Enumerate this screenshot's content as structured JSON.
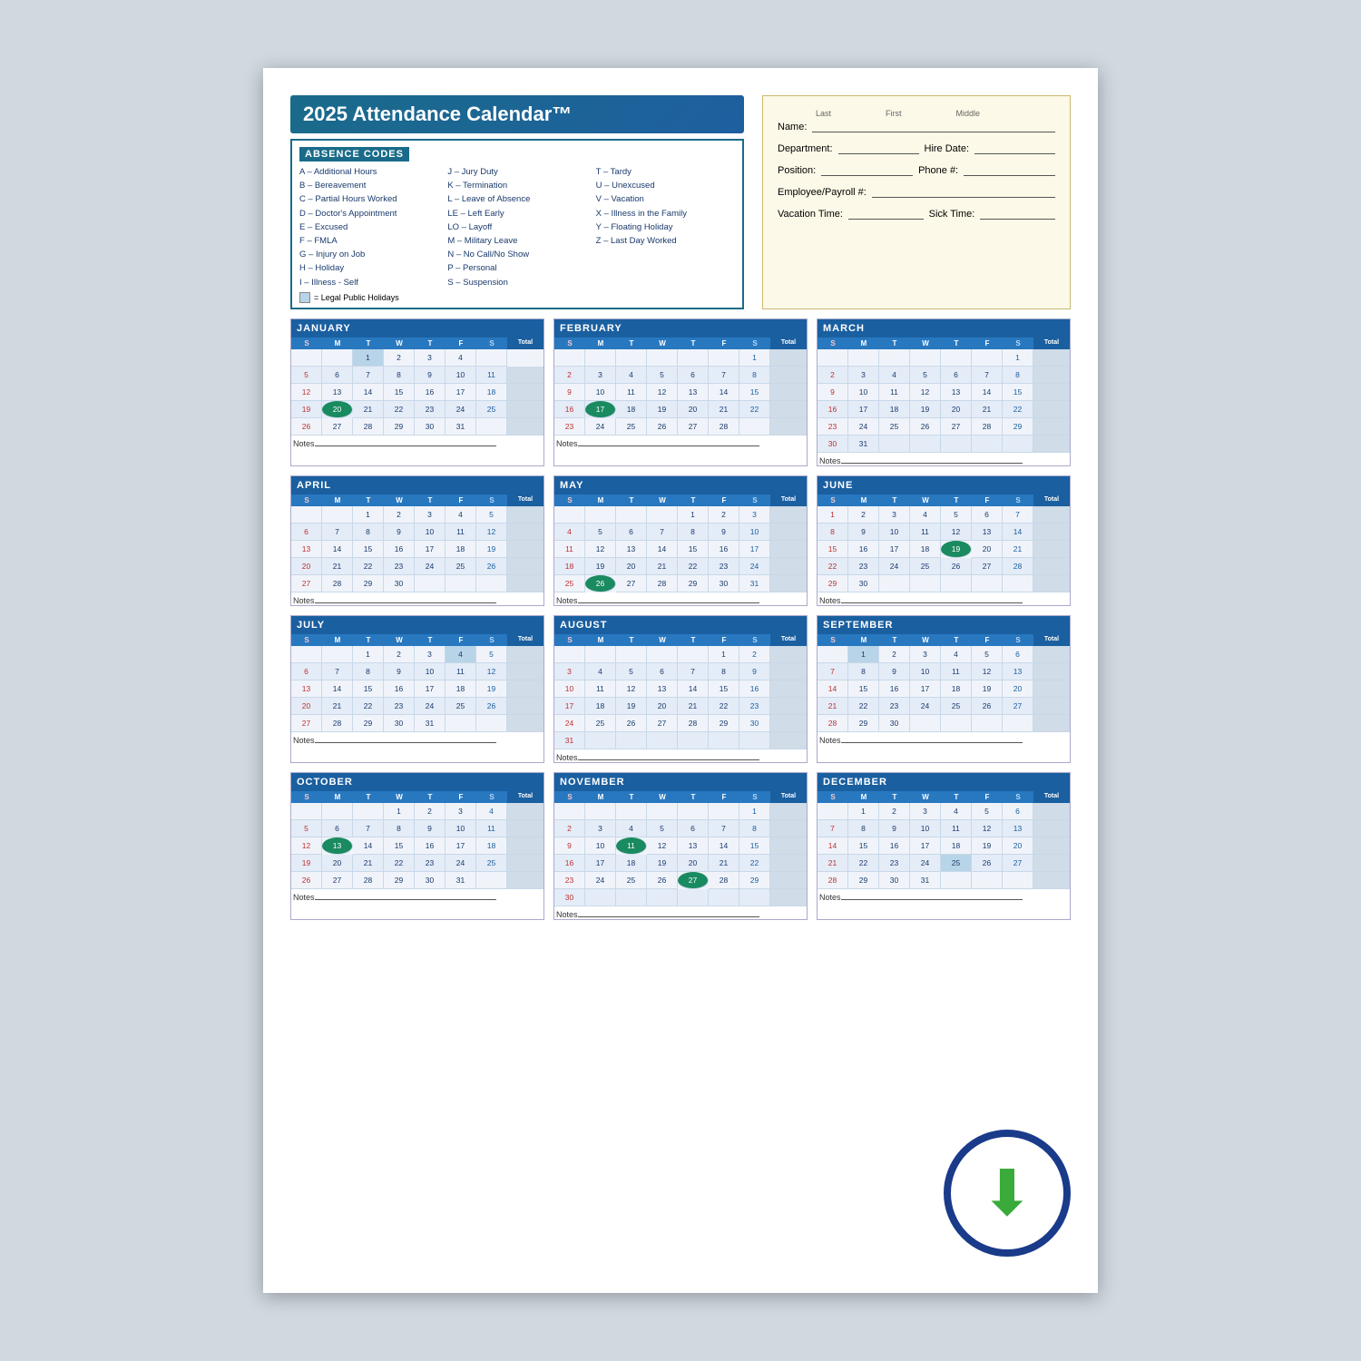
{
  "title": "2025 Attendance Calendar™",
  "absence_codes_title": "ABSENCE CODES",
  "codes_left": [
    "A – Additional Hours",
    "B – Bereavement",
    "C – Partial Hours Worked",
    "D – Doctor's Appointment",
    "E – Excused",
    "F – FMLA",
    "G – Injury on Job",
    "H – Holiday",
    "I  – Illness - Self"
  ],
  "codes_middle": [
    "J  – Jury Duty",
    "K – Termination",
    "L  – Leave of Absence",
    "LE – Left Early",
    "LO – Layoff",
    "M – Military Leave",
    "N – No Call/No Show",
    "P  – Personal",
    "S  – Suspension"
  ],
  "codes_right": [
    "T – Tardy",
    "U – Unexcused",
    "V – Vacation",
    "X – Illness in the Family",
    "Y – Floating Holiday",
    "Z – Last Day Worked",
    "–",
    "–"
  ],
  "legend_label": "= Legal Public Holidays",
  "info": {
    "name_label": "Name:",
    "last_label": "Last",
    "first_label": "First",
    "middle_label": "Middle",
    "dept_label": "Department:",
    "hire_label": "Hire Date:",
    "position_label": "Position:",
    "phone_label": "Phone #:",
    "emp_label": "Employee/Payroll #:",
    "vacation_label": "Vacation Time:",
    "sick_label": "Sick Time:"
  },
  "months": [
    {
      "name": "JANUARY",
      "days_header": [
        "S",
        "M",
        "T",
        "W",
        "T",
        "F",
        "S",
        "Total"
      ],
      "rows": [
        [
          "",
          "",
          "1",
          "2",
          "3",
          "4",
          ""
        ],
        [
          "5",
          "6",
          "7",
          "8",
          "9",
          "10",
          "11",
          ""
        ],
        [
          "12",
          "13",
          "14",
          "15",
          "16",
          "17",
          "18",
          ""
        ],
        [
          "19",
          "20",
          "21",
          "22",
          "23",
          "24",
          "25",
          ""
        ],
        [
          "26",
          "27",
          "28",
          "29",
          "30",
          "31",
          "",
          ""
        ]
      ],
      "holidays": [
        "1"
      ],
      "highlights": [
        "20"
      ]
    },
    {
      "name": "FEBRUARY",
      "days_header": [
        "S",
        "M",
        "T",
        "W",
        "T",
        "F",
        "S",
        "Total"
      ],
      "rows": [
        [
          "",
          "",
          "",
          "",
          "",
          "",
          "1",
          ""
        ],
        [
          "2",
          "3",
          "4",
          "5",
          "6",
          "7",
          "8",
          ""
        ],
        [
          "9",
          "10",
          "11",
          "12",
          "13",
          "14",
          "15",
          ""
        ],
        [
          "16",
          "17",
          "18",
          "19",
          "20",
          "21",
          "22",
          ""
        ],
        [
          "23",
          "24",
          "25",
          "26",
          "27",
          "28",
          "",
          ""
        ]
      ],
      "holidays": [],
      "highlights": [
        "17"
      ]
    },
    {
      "name": "MARCH",
      "days_header": [
        "S",
        "M",
        "T",
        "W",
        "T",
        "F",
        "S",
        "Total"
      ],
      "rows": [
        [
          "",
          "",
          "",
          "",
          "",
          "",
          "1",
          ""
        ],
        [
          "2",
          "3",
          "4",
          "5",
          "6",
          "7",
          "8",
          ""
        ],
        [
          "9",
          "10",
          "11",
          "12",
          "13",
          "14",
          "15",
          ""
        ],
        [
          "16",
          "17",
          "18",
          "19",
          "20",
          "21",
          "22",
          ""
        ],
        [
          "23",
          "24",
          "25",
          "26",
          "27",
          "28",
          "29",
          ""
        ],
        [
          "30",
          "31",
          "",
          "",
          "",
          "",
          "",
          ""
        ]
      ],
      "holidays": [],
      "highlights": []
    },
    {
      "name": "APRIL",
      "days_header": [
        "S",
        "M",
        "T",
        "W",
        "T",
        "F",
        "S",
        "Total"
      ],
      "rows": [
        [
          "",
          "",
          "1",
          "2",
          "3",
          "4",
          "5",
          ""
        ],
        [
          "6",
          "7",
          "8",
          "9",
          "10",
          "11",
          "12",
          ""
        ],
        [
          "13",
          "14",
          "15",
          "16",
          "17",
          "18",
          "19",
          ""
        ],
        [
          "20",
          "21",
          "22",
          "23",
          "24",
          "25",
          "26",
          ""
        ],
        [
          "27",
          "28",
          "29",
          "30",
          "",
          "",
          "",
          ""
        ]
      ],
      "holidays": [],
      "highlights": []
    },
    {
      "name": "MAY",
      "days_header": [
        "S",
        "M",
        "T",
        "W",
        "T",
        "F",
        "S",
        "Total"
      ],
      "rows": [
        [
          "",
          "",
          "",
          "",
          "1",
          "2",
          "3",
          ""
        ],
        [
          "4",
          "5",
          "6",
          "7",
          "8",
          "9",
          "10",
          ""
        ],
        [
          "11",
          "12",
          "13",
          "14",
          "15",
          "16",
          "17",
          ""
        ],
        [
          "18",
          "19",
          "20",
          "21",
          "22",
          "23",
          "24",
          ""
        ],
        [
          "25",
          "26",
          "27",
          "28",
          "29",
          "30",
          "31",
          ""
        ]
      ],
      "holidays": [],
      "highlights": [
        "26"
      ]
    },
    {
      "name": "JUNE",
      "days_header": [
        "S",
        "M",
        "T",
        "W",
        "T",
        "F",
        "S",
        "Total"
      ],
      "rows": [
        [
          "1",
          "2",
          "3",
          "4",
          "5",
          "6",
          "7",
          ""
        ],
        [
          "8",
          "9",
          "10",
          "11",
          "12",
          "13",
          "14",
          ""
        ],
        [
          "15",
          "16",
          "17",
          "18",
          "19",
          "20",
          "21",
          ""
        ],
        [
          "22",
          "23",
          "24",
          "25",
          "26",
          "27",
          "28",
          ""
        ],
        [
          "29",
          "30",
          "",
          "",
          "",
          "",
          "",
          ""
        ]
      ],
      "holidays": [],
      "highlights": [
        "19"
      ]
    },
    {
      "name": "JULY",
      "days_header": [
        "S",
        "M",
        "T",
        "W",
        "T",
        "F",
        "S",
        "Total"
      ],
      "rows": [
        [
          "",
          "",
          "1",
          "2",
          "3",
          "4",
          "5",
          ""
        ],
        [
          "6",
          "7",
          "8",
          "9",
          "10",
          "11",
          "12",
          ""
        ],
        [
          "13",
          "14",
          "15",
          "16",
          "17",
          "18",
          "19",
          ""
        ],
        [
          "20",
          "21",
          "22",
          "23",
          "24",
          "25",
          "26",
          ""
        ],
        [
          "27",
          "28",
          "29",
          "30",
          "31",
          "",
          "",
          ""
        ]
      ],
      "holidays": [
        "4"
      ],
      "highlights": []
    },
    {
      "name": "AUGUST",
      "days_header": [
        "S",
        "M",
        "T",
        "W",
        "T",
        "F",
        "S",
        "Total"
      ],
      "rows": [
        [
          "",
          "",
          "",
          "",
          "",
          "1",
          "2",
          ""
        ],
        [
          "3",
          "4",
          "5",
          "6",
          "7",
          "8",
          "9",
          ""
        ],
        [
          "10",
          "11",
          "12",
          "13",
          "14",
          "15",
          "16",
          ""
        ],
        [
          "17",
          "18",
          "19",
          "20",
          "21",
          "22",
          "23",
          ""
        ],
        [
          "24",
          "25",
          "26",
          "27",
          "28",
          "29",
          "30",
          ""
        ],
        [
          "31",
          "",
          "",
          "",
          "",
          "",
          "",
          ""
        ]
      ],
      "holidays": [],
      "highlights": []
    },
    {
      "name": "SEPTEMBER",
      "days_header": [
        "S",
        "M",
        "T",
        "W",
        "T",
        "F",
        "S",
        "Total"
      ],
      "rows": [
        [
          "",
          "1",
          "2",
          "3",
          "4",
          "5",
          "6",
          ""
        ],
        [
          "7",
          "8",
          "9",
          "10",
          "11",
          "12",
          "13",
          ""
        ],
        [
          "14",
          "15",
          "16",
          "17",
          "18",
          "19",
          "20",
          ""
        ],
        [
          "21",
          "22",
          "23",
          "24",
          "25",
          "26",
          "27",
          ""
        ],
        [
          "28",
          "29",
          "30",
          "",
          "",
          "",
          "",
          ""
        ]
      ],
      "holidays": [
        "1"
      ],
      "highlights": []
    },
    {
      "name": "OCTOBER",
      "days_header": [
        "S",
        "M",
        "T",
        "W",
        "T",
        "F",
        "S",
        "Total"
      ],
      "rows": [
        [
          "",
          "",
          "",
          "1",
          "2",
          "3",
          "4",
          ""
        ],
        [
          "5",
          "6",
          "7",
          "8",
          "9",
          "10",
          "11",
          ""
        ],
        [
          "12",
          "13",
          "14",
          "15",
          "16",
          "17",
          "18",
          ""
        ],
        [
          "19",
          "20",
          "21",
          "22",
          "23",
          "24",
          "25",
          ""
        ],
        [
          "26",
          "27",
          "28",
          "29",
          "30",
          "31",
          "",
          ""
        ]
      ],
      "holidays": [],
      "highlights": [
        "13"
      ]
    },
    {
      "name": "NOVEMBER",
      "days_header": [
        "S",
        "M",
        "T",
        "W",
        "T",
        "F",
        "S",
        "Total"
      ],
      "rows": [
        [
          "",
          "",
          "",
          "",
          "",
          "",
          "1",
          ""
        ],
        [
          "2",
          "3",
          "4",
          "5",
          "6",
          "7",
          "8",
          ""
        ],
        [
          "9",
          "10",
          "11",
          "12",
          "13",
          "14",
          "15",
          ""
        ],
        [
          "16",
          "17",
          "18",
          "19",
          "20",
          "21",
          "22",
          ""
        ],
        [
          "23",
          "24",
          "25",
          "26",
          "27",
          "28",
          "29",
          ""
        ],
        [
          "30",
          "",
          "",
          "",
          "",
          "",
          "",
          ""
        ]
      ],
      "holidays": [],
      "highlights": [
        "11",
        "27"
      ]
    },
    {
      "name": "DECEMBER",
      "days_header": [
        "S",
        "M",
        "T",
        "W",
        "T",
        "F",
        "S",
        "Total"
      ],
      "rows": [
        [
          "",
          "1",
          "2",
          "3",
          "4",
          "5",
          "6",
          ""
        ],
        [
          "7",
          "8",
          "9",
          "10",
          "11",
          "12",
          "13",
          ""
        ],
        [
          "14",
          "15",
          "16",
          "17",
          "18",
          "19",
          "20",
          ""
        ],
        [
          "21",
          "22",
          "23",
          "24",
          "25",
          "26",
          "27",
          ""
        ],
        [
          "28",
          "29",
          "30",
          "31",
          "",
          "",
          "",
          ""
        ]
      ],
      "holidays": [
        "25"
      ],
      "highlights": []
    }
  ],
  "notes_label": "Notes"
}
